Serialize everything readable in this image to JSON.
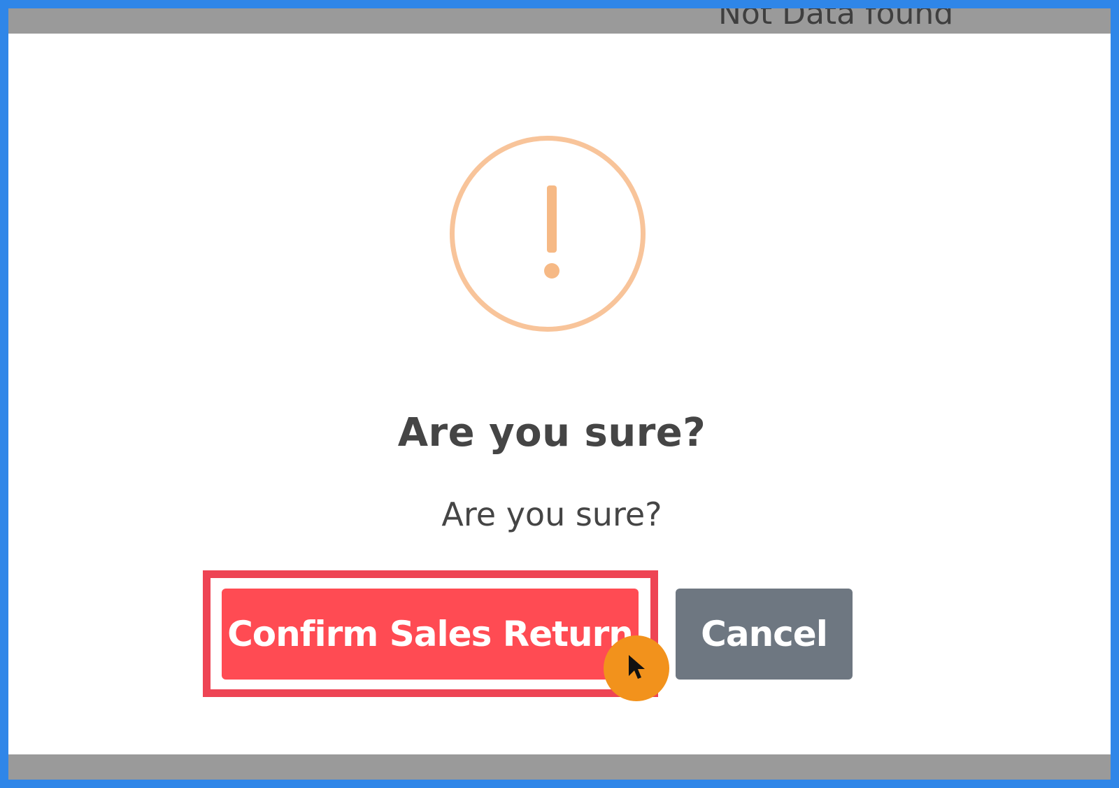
{
  "background": {
    "empty_state_text": "Not Data found"
  },
  "dialog": {
    "title": "Are you sure?",
    "text": "Are you sure?",
    "confirm_label": "Confirm Sales Return",
    "cancel_label": "Cancel",
    "icon": "warning-exclamation-icon"
  },
  "colors": {
    "frame": "#2f86e8",
    "confirm": "#ff4b53",
    "cancel": "#6e7781",
    "warning": "#f8c49a",
    "highlight": "#ee4454",
    "cursor_badge": "#f2921c"
  }
}
